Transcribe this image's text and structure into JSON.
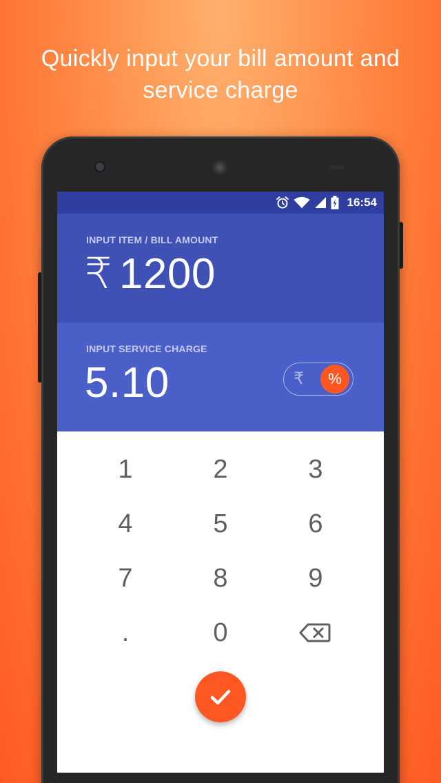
{
  "headline": {
    "line1": "Quickly input your bill amount and",
    "line2": "service charge"
  },
  "status_bar": {
    "time": "16:54",
    "icons": [
      "alarm-icon",
      "wifi-icon",
      "signal-icon",
      "battery-charging-icon"
    ]
  },
  "bill": {
    "label": "INPUT ITEM / BILL AMOUNT",
    "currency_symbol": "₹",
    "value": "1200"
  },
  "service_charge": {
    "label": "INPUT SERVICE CHARGE",
    "value": "5.10",
    "toggle": {
      "rupee_option": "₹",
      "percent_option": "%",
      "selected": "%"
    }
  },
  "keypad": {
    "keys": [
      "1",
      "2",
      "3",
      "4",
      "5",
      "6",
      "7",
      "8",
      "9",
      ".",
      "0"
    ],
    "backspace_icon": "backspace-icon",
    "confirm_icon": "check-icon"
  },
  "colors": {
    "background_accent": "#ff6a30",
    "status_bar": "#303f9f",
    "bill_panel": "#3f51b5",
    "service_panel": "#4a5fc8",
    "accent": "#ff5722",
    "key_text": "#5f5f5f"
  }
}
